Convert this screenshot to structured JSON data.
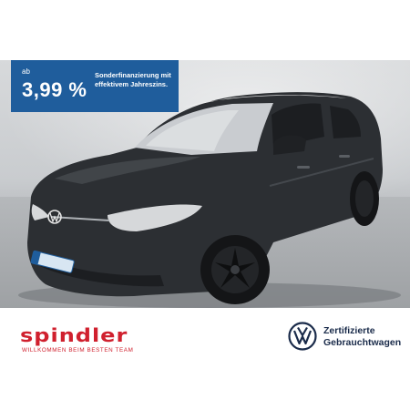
{
  "promo": {
    "prefix": "ab",
    "rate": "3,99 %",
    "line1": "Sonderfinanzierung mit",
    "line2": "effektivem Jahreszins."
  },
  "dealer": {
    "name": "spindler",
    "tagline": "WILLKOMMEN BEIM BESTEN TEAM"
  },
  "certification": {
    "logo": "vw-logo-icon",
    "line1": "Zertifizierte",
    "line2": "Gebrauchtwagen"
  },
  "colors": {
    "promo_background": "#1f5d9c",
    "dealer_red": "#d0202e",
    "vw_navy": "#1a2b4a",
    "car_body": "#2c2f33"
  }
}
